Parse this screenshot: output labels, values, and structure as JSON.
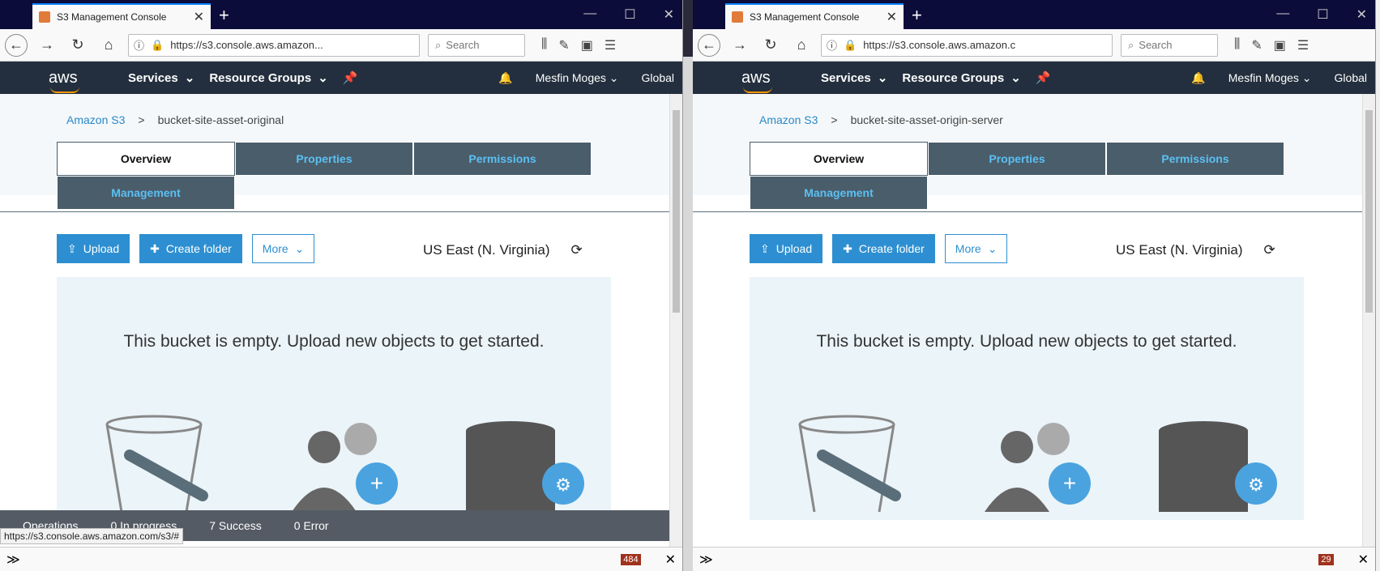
{
  "windows": [
    {
      "tab_title": "S3 Management Console",
      "url": "https://s3.console.aws.amazon...",
      "search_placeholder": "Search",
      "aws": {
        "services": "Services",
        "resource_groups": "Resource Groups",
        "user": "Mesfin Moges",
        "region_menu": "Global"
      },
      "breadcrumb": {
        "root": "Amazon S3",
        "sep": ">",
        "bucket": "bucket-site-asset-original"
      },
      "tabs": [
        "Overview",
        "Properties",
        "Permissions",
        "Management"
      ],
      "toolbar": {
        "upload": "Upload",
        "create_folder": "Create folder",
        "more": "More"
      },
      "region": "US East (N. Virginia)",
      "empty_message": "This bucket is empty. Upload new objects to get started.",
      "status": {
        "operations": "Operations",
        "in_progress": "0 In progress",
        "success": "7 Success",
        "error": "0 Error"
      },
      "url_hint": "https://s3.console.aws.amazon.com/s3/#",
      "badge": "484"
    },
    {
      "tab_title": "S3 Management Console",
      "url": "https://s3.console.aws.amazon.c",
      "search_placeholder": "Search",
      "aws": {
        "services": "Services",
        "resource_groups": "Resource Groups",
        "user": "Mesfin Moges",
        "region_menu": "Global"
      },
      "breadcrumb": {
        "root": "Amazon S3",
        "sep": ">",
        "bucket": "bucket-site-asset-origin-server"
      },
      "tabs": [
        "Overview",
        "Properties",
        "Permissions",
        "Management"
      ],
      "toolbar": {
        "upload": "Upload",
        "create_folder": "Create folder",
        "more": "More"
      },
      "region": "US East (N. Virginia)",
      "empty_message": "This bucket is empty. Upload new objects to get started.",
      "badge": "29"
    }
  ],
  "icons": {
    "lock": "lock-icon",
    "bell": "bell-icon",
    "pin": "pin-icon",
    "refresh": "refresh-icon"
  },
  "colors": {
    "aws_nav": "#232f3e",
    "tab_bg": "#4a5d6b",
    "tab_text": "#5bc0f2",
    "button": "#2d8fd1",
    "orange": "#f90"
  }
}
